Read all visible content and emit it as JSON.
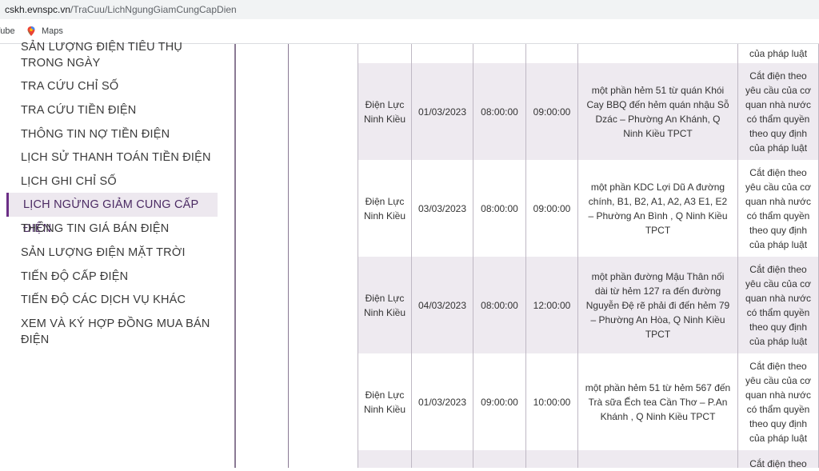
{
  "browser": {
    "url_domain": "cskh.evnspc.vn",
    "url_path": "/TraCuu/LichNgungGiamCungCapDien",
    "bookmarks": [
      {
        "label": "Tube"
      },
      {
        "label": "Maps"
      }
    ]
  },
  "sidebar": {
    "items": [
      {
        "label": "SẢN LƯỢNG ĐIỆN TIÊU THỤ TRONG NGÀY"
      },
      {
        "label": "TRA CỨU CHỈ SỐ"
      },
      {
        "label": "TRA CỨU TIỀN ĐIỆN"
      },
      {
        "label": "THÔNG TIN NỢ TIỀN ĐIỆN"
      },
      {
        "label": "LỊCH SỬ THANH TOÁN TIỀN ĐIỆN"
      },
      {
        "label": "LỊCH GHI CHỈ SỐ"
      },
      {
        "label": "LỊCH NGỪNG GIẢM CUNG CẤP ĐIỆN"
      },
      {
        "label": "THÔNG TIN GIÁ BÁN ĐIỆN"
      },
      {
        "label": "SẢN LƯỢNG ĐIỆN MẶT TRỜI"
      },
      {
        "label": "TIẾN ĐỘ CẤP ĐIỆN"
      },
      {
        "label": "TIẾN ĐỘ CÁC DỊCH VỤ KHÁC"
      },
      {
        "label": "XEM VÀ KÝ HỢP ĐỒNG MUA BÁN ĐIỆN"
      }
    ]
  },
  "table": {
    "rows": [
      {
        "unit": "",
        "date": "",
        "start": "",
        "end": "",
        "area": "",
        "reason": "của pháp luật"
      },
      {
        "unit": "Điện Lực Ninh Kiều",
        "date": "01/03/2023",
        "start": "08:00:00",
        "end": "09:00:00",
        "area": "một phần hẻm 51 từ quán Khói Cay BBQ đến hẻm quán nhậu Sỗ Dzác – Phường An Khánh, Q Ninh Kiều TPCT",
        "reason": "Cắt điện theo yêu cầu của cơ quan nhà nước có thẩm quyền theo quy định của pháp luật"
      },
      {
        "unit": "Điện Lực Ninh Kiều",
        "date": "03/03/2023",
        "start": "08:00:00",
        "end": "09:00:00",
        "area": "một phần KDC Lợi Dũ A đường chính, B1, B2, A1, A2, A3 E1, E2 – Phường An Bình , Q Ninh Kiều TPCT",
        "reason": "Cắt điện theo yêu cầu của cơ quan nhà nước có thẩm quyền theo quy định của pháp luật"
      },
      {
        "unit": "Điện Lực Ninh Kiều",
        "date": "04/03/2023",
        "start": "08:00:00",
        "end": "12:00:00",
        "area": "một phần đường Mậu Thân nối dài từ hẻm 127 ra đến đường Nguyễn Đệ rẽ phải đi đến hẻm 79 – Phường An Hòa, Q Ninh Kiều TPCT",
        "reason": "Cắt điện theo yêu cầu của cơ quan nhà nước có thẩm quyền theo quy định của pháp luật"
      },
      {
        "unit": "Điện Lực Ninh Kiều",
        "date": "01/03/2023",
        "start": "09:00:00",
        "end": "10:00:00",
        "area": "một phần hẻm 51 từ hẻm 567 đến Trà sữa Ếch tea Cần Thơ – P.An Khánh , Q Ninh Kiều TPCT",
        "reason": "Cắt điện theo yêu cầu của cơ quan nhà nước có thẩm quyền theo quy định của pháp luật"
      },
      {
        "unit": "",
        "date": "",
        "start": "",
        "end": "",
        "area": "",
        "reason": "Cắt điện theo"
      }
    ]
  },
  "colors": {
    "accent": "#6b2e86",
    "active_bg": "#ede8ef",
    "row_shade": "#eeeaf0",
    "border": "#bfb8c4"
  }
}
